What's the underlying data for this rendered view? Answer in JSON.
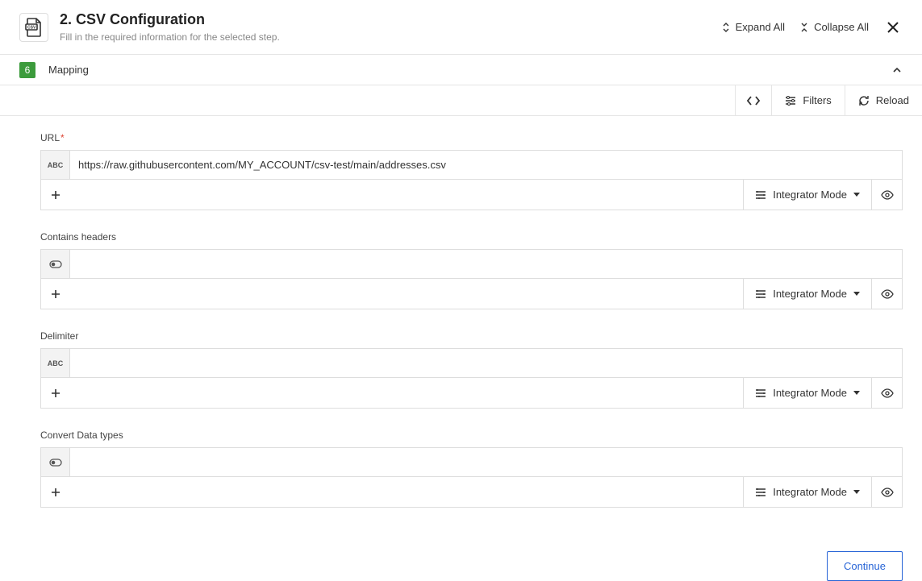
{
  "header": {
    "title": "2. CSV Configuration",
    "subtitle": "Fill in the required information for the selected step.",
    "expand": "Expand All",
    "collapse": "Collapse All"
  },
  "section": {
    "badge": "6",
    "title": "Mapping"
  },
  "toolbar": {
    "filters": "Filters",
    "reload": "Reload"
  },
  "fields": {
    "url": {
      "label": "URL",
      "type": "ABC",
      "value": "https://raw.githubusercontent.com/MY_ACCOUNT/csv-test/main/addresses.csv",
      "mode": "Integrator Mode"
    },
    "headers": {
      "label": "Contains headers",
      "type": "toggle",
      "value": "",
      "mode": "Integrator Mode"
    },
    "delimiter": {
      "label": "Delimiter",
      "type": "ABC",
      "value": "",
      "mode": "Integrator Mode"
    },
    "convert": {
      "label": "Convert Data types",
      "type": "toggle",
      "value": "",
      "mode": "Integrator Mode"
    }
  },
  "footer": {
    "continue": "Continue"
  }
}
